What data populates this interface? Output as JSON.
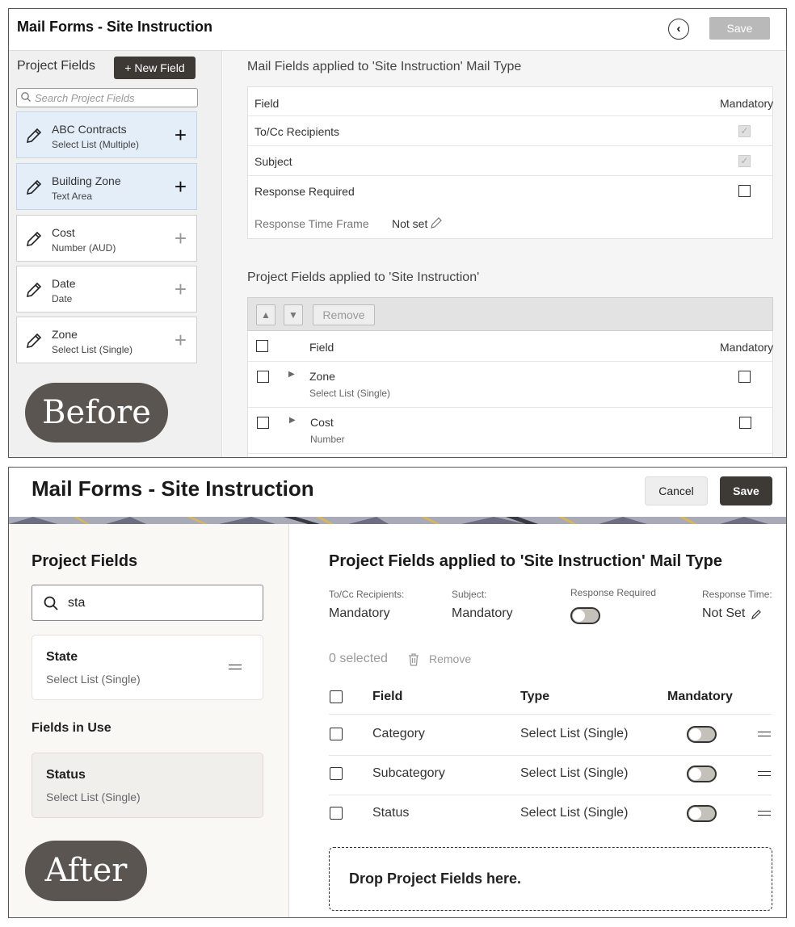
{
  "before": {
    "title": "Mail Forms - Site Instruction",
    "back_icon": "chevron-left-icon",
    "save_label": "Save",
    "project_fields_label": "Project Fields",
    "new_field_label": "+ New Field",
    "search_placeholder": "Search Project Fields",
    "fields": [
      {
        "name": "ABC Contracts",
        "type": "Select List (Multiple)"
      },
      {
        "name": "Building Zone",
        "type": "Text Area"
      },
      {
        "name": "Cost",
        "type": "Number (AUD)"
      },
      {
        "name": "Date",
        "type": "Date"
      },
      {
        "name": "Zone",
        "type": "Select List (Single)"
      }
    ],
    "badge": "Before",
    "mail_fields_title": "Mail Fields applied to 'Site Instruction' Mail Type",
    "mail_fields_header": {
      "field": "Field",
      "mandatory": "Mandatory"
    },
    "mail_fields": [
      {
        "label": "To/Cc Recipients",
        "checked": true
      },
      {
        "label": "Subject",
        "checked": true
      },
      {
        "label": "Response Required",
        "checked": false
      }
    ],
    "response_time_label": "Response Time Frame",
    "response_time_value": "Not set",
    "project_fields_applied_title": "Project Fields applied to 'Site Instruction'",
    "remove_label": "Remove",
    "pf_header": {
      "field": "Field",
      "mandatory": "Mandatory"
    },
    "pf_rows": [
      {
        "name": "Zone",
        "type": "Select List (Single)"
      },
      {
        "name": "Cost",
        "type": "Number"
      }
    ]
  },
  "after": {
    "title": "Mail Forms - Site Instruction",
    "cancel_label": "Cancel",
    "save_label": "Save",
    "project_fields_label": "Project Fields",
    "search_value": "sta",
    "search_result": {
      "name": "State",
      "type": "Select List (Single)"
    },
    "fields_in_use_label": "Fields in Use",
    "fields_in_use": {
      "name": "Status",
      "type": "Select List (Single)"
    },
    "badge": "After",
    "main_title": "Project Fields applied to 'Site Instruction' Mail Type",
    "meta": {
      "recipients_label": "To/Cc Recipients:",
      "recipients_value": "Mandatory",
      "subject_label": "Subject:",
      "subject_value": "Mandatory",
      "response_required_label": "Response Required",
      "response_time_label": "Response Time:",
      "response_time_value": "Not Set"
    },
    "selected_count": "0 selected",
    "remove_label": "Remove",
    "table_headers": {
      "field": "Field",
      "type": "Type",
      "mandatory": "Mandatory"
    },
    "rows": [
      {
        "field": "Category",
        "type": "Select List (Single)"
      },
      {
        "field": "Subcategory",
        "type": "Select List (Single)"
      },
      {
        "field": "Status",
        "type": "Select List (Single)"
      }
    ],
    "drop_zone": "Drop Project Fields here."
  },
  "colors": {
    "dark_button": "#3d3935",
    "link": "#1b6d8f",
    "badge": "#5a5551",
    "selected_card": "#e4eef8"
  }
}
